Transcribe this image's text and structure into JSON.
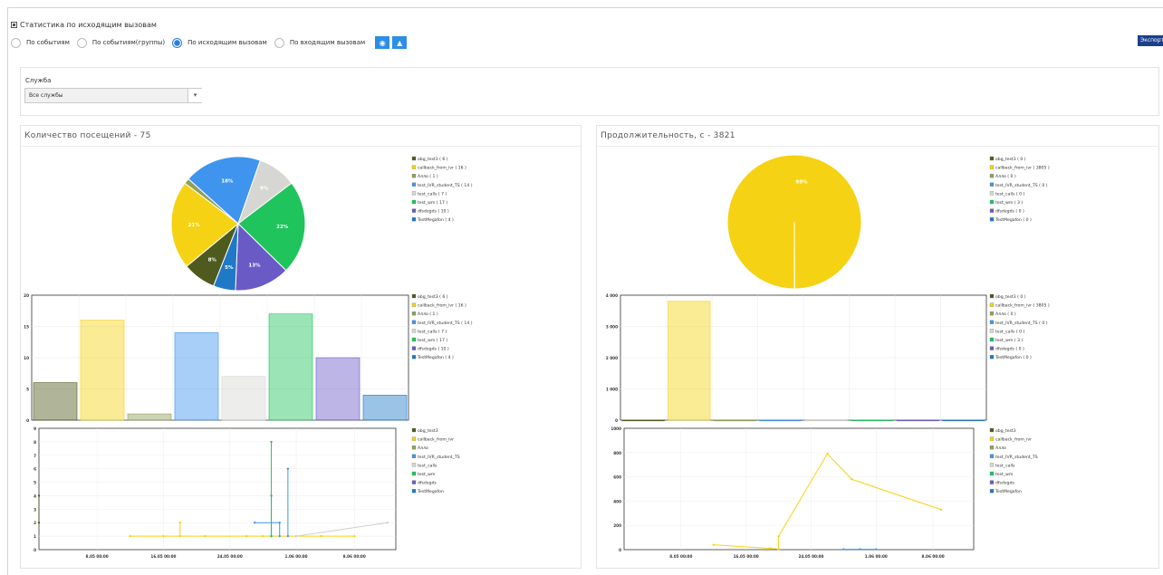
{
  "header": {
    "title": "Статистика по исходящим вызовам",
    "radios": [
      {
        "label": "По событиям",
        "checked": false
      },
      {
        "label": "По событиям(группы)",
        "checked": false
      },
      {
        "label": "По исходящим вызовам",
        "checked": true
      },
      {
        "label": "По входящим вызовам",
        "checked": false
      }
    ],
    "view_buttons": [
      "pie-chart-icon",
      "area-chart-icon"
    ],
    "export_label": "Экспорт"
  },
  "filter": {
    "label": "Служба",
    "selected": "Все службы"
  },
  "legend_series": [
    {
      "name": "obg_test3",
      "color": "#4f5a1e"
    },
    {
      "name": "callback_from_ivr",
      "color": "#f5d214"
    },
    {
      "name": "Алло",
      "color": "#8fa05a"
    },
    {
      "name": "test_IVR_student_TS",
      "color": "#3f94ee"
    },
    {
      "name": "test_calls",
      "color": "#d6d6d2"
    },
    {
      "name": "test_wm",
      "color": "#1fc45c"
    },
    {
      "name": "dfsdegds",
      "color": "#6a5ac6"
    },
    {
      "name": "TestMegafon",
      "color": "#1f79c7"
    }
  ],
  "icons": {
    "radio_checked": "#2a7be4",
    "export_bg": "#1c3f8a"
  },
  "panels": [
    {
      "title": "Количество посещений - 75",
      "counts": [
        6,
        16,
        1,
        14,
        7,
        17,
        10,
        4
      ],
      "pie_labels": [
        "8%",
        "21%",
        "",
        "18%",
        "9%",
        "22%",
        "13%",
        "5%"
      ]
    },
    {
      "title": "Продолжительность, с - 3821",
      "counts": [
        0,
        3805,
        0,
        0,
        0,
        3,
        0,
        0
      ],
      "pie_labels": [
        "",
        "99%",
        "",
        "",
        "",
        "",
        "",
        ""
      ]
    }
  ],
  "chart_data": [
    {
      "type": "pie",
      "title": "Количество посещений - 75",
      "categories": [
        "obg_test3",
        "callback_from_ivr",
        "Алло",
        "test_IVR_student_TS",
        "test_calls",
        "test_wm",
        "dfsdegds",
        "TestMegafon"
      ],
      "values": [
        6,
        16,
        1,
        14,
        7,
        17,
        10,
        4
      ]
    },
    {
      "type": "bar",
      "categories": [
        "obg_test3",
        "callback_from_ivr",
        "Алло",
        "test_IVR_student_TS",
        "test_calls",
        "test_wm",
        "dfsdegds",
        "TestMegafon"
      ],
      "values": [
        6,
        16,
        1,
        14,
        7,
        17,
        10,
        4
      ],
      "ylim": [
        0,
        20
      ],
      "yticks": [
        "0",
        "5",
        "10",
        "15",
        "20"
      ]
    },
    {
      "type": "line",
      "x_ticks": [
        "8.05 00:00",
        "16.05 00:00",
        "24.05 00:00",
        "1.06 00:00",
        "8.06 00:00"
      ],
      "ylim": [
        0,
        9
      ],
      "yticks": [
        "0",
        "1",
        "2",
        "3",
        "4",
        "5",
        "6",
        "7",
        "8",
        "9"
      ],
      "series": [
        {
          "name": "obg_test3",
          "x": [
            "1.05 00:00",
            "1.05 00:00"
          ],
          "y": [
            4,
            2
          ]
        },
        {
          "name": "callback_from_ivr",
          "x": [
            "12.05 00:00",
            "16.05 00:00",
            "21.05 00:00",
            "26.05 00:00",
            "28.05 00:00",
            "1.06 00:00",
            "4.06 00:00",
            "8.06 00:00"
          ],
          "y": [
            1,
            1,
            1,
            1,
            1,
            1,
            1,
            1
          ]
        },
        {
          "name": "callback_from_ivr",
          "x": [
            "18.05 00:00",
            "18.05 00:00"
          ],
          "y": [
            2,
            1
          ]
        },
        {
          "name": "test_IVR_student_TS",
          "x": [
            "27.05 00:00",
            "30.05 00:00",
            "30.05 00:00"
          ],
          "y": [
            2,
            2,
            1
          ]
        },
        {
          "name": "test_IVR_student_TS",
          "x": [
            "29.05 00:00",
            "29.05 00:00"
          ],
          "y": [
            4,
            1
          ]
        },
        {
          "name": "test_IVR_student_TS",
          "x": [
            "31.05 00:00",
            "31.05 00:00"
          ],
          "y": [
            6,
            1
          ]
        },
        {
          "name": "test_wm",
          "x": [
            "29.05 00:00",
            "29.05 00:00"
          ],
          "y": [
            8,
            1
          ]
        },
        {
          "name": "test_calls",
          "x": [
            "1.06 00:00",
            "12.06 00:00"
          ],
          "y": [
            1,
            2
          ]
        }
      ]
    },
    {
      "type": "pie",
      "title": "Продолжительность, с - 3821",
      "categories": [
        "obg_test3",
        "callback_from_ivr",
        "Алло",
        "test_IVR_student_TS",
        "test_calls",
        "test_wm",
        "dfsdegds",
        "TestMegafon"
      ],
      "values": [
        0,
        3805,
        0,
        0,
        0,
        3,
        0,
        0
      ]
    },
    {
      "type": "bar",
      "categories": [
        "obg_test3",
        "callback_from_ivr",
        "Алло",
        "test_IVR_student_TS",
        "test_calls",
        "test_wm",
        "dfsdegds",
        "TestMegafon"
      ],
      "values": [
        0,
        3805,
        0,
        0,
        0,
        3,
        0,
        0
      ],
      "ylim": [
        0,
        4000
      ],
      "yticks": [
        "0",
        "1 000",
        "2 000",
        "3 000",
        "4 000"
      ]
    },
    {
      "type": "line",
      "x_ticks": [
        "8.05 00:00",
        "16.05 00:00",
        "24.05 00:00",
        "1.06 00:00",
        "8.06 00:00"
      ],
      "ylim": [
        0,
        1000
      ],
      "yticks": [
        "0",
        "200",
        "400",
        "600",
        "800",
        "1000"
      ],
      "series": [
        {
          "name": "callback_from_ivr",
          "x": [
            "12.05 00:00",
            "19.05 00:00",
            "20.05 00:00",
            "20.05 00:00",
            "26.05 00:00",
            "29.05 00:00",
            "9.06 00:00"
          ],
          "y": [
            40,
            10,
            5,
            110,
            790,
            580,
            330
          ]
        },
        {
          "name": "test_IVR_student_TS",
          "x": [
            "28.05 00:00",
            "30.05 00:00",
            "1.06 00:00"
          ],
          "y": [
            3,
            3,
            3
          ]
        }
      ]
    }
  ]
}
